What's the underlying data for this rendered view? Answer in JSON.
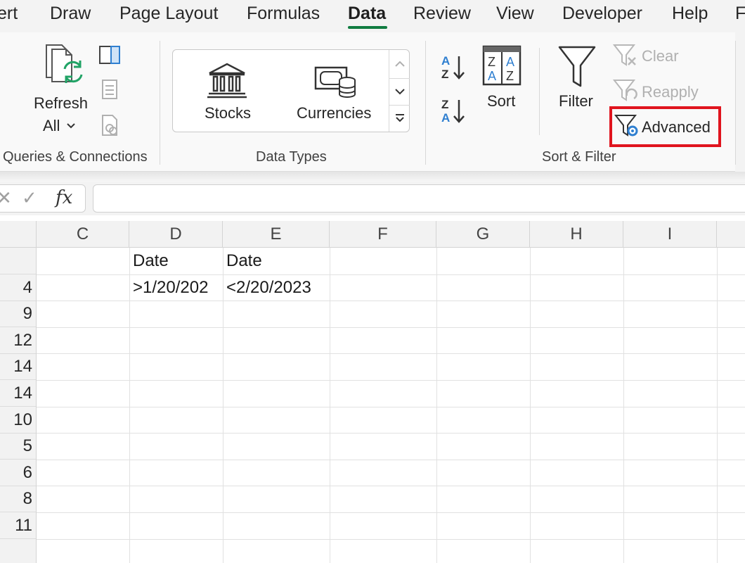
{
  "menu": {
    "tabs": [
      {
        "label": "ert",
        "active": false
      },
      {
        "label": "Draw",
        "active": false
      },
      {
        "label": "Page Layout",
        "active": false
      },
      {
        "label": "Formulas",
        "active": false
      },
      {
        "label": "Data",
        "active": true
      },
      {
        "label": "Review",
        "active": false
      },
      {
        "label": "View",
        "active": false
      },
      {
        "label": "Developer",
        "active": false
      },
      {
        "label": "Help",
        "active": false
      },
      {
        "label": "F",
        "active": false
      }
    ]
  },
  "ribbon": {
    "queries": {
      "refresh_label": "Refresh",
      "all_label": "All",
      "group_label": "Queries & Connections"
    },
    "data_types": {
      "stocks_label": "Stocks",
      "currencies_label": "Currencies",
      "group_label": "Data Types"
    },
    "sort_filter": {
      "sort_label": "Sort",
      "filter_label": "Filter",
      "clear_label": "Clear",
      "reapply_label": "Reapply",
      "advanced_label": "Advanced",
      "group_label": "Sort & Filter"
    },
    "colors": {
      "accent_green": "#107c41",
      "highlight_red": "#e0141e",
      "sort_blue": "#2f7fd0"
    }
  },
  "formula_bar": {
    "fx_label": "fx",
    "cancel_glyph": "✕",
    "enter_glyph": "✓",
    "value": ""
  },
  "sheet": {
    "columns": [
      "C",
      "D",
      "E",
      "F",
      "G",
      "H",
      "I"
    ],
    "rows": [
      {
        "header": "",
        "cells": [
          "",
          "Date",
          "Date",
          "",
          "",
          "",
          ""
        ]
      },
      {
        "header": "4",
        "cells": [
          "",
          ">1/20/202",
          "<2/20/2023",
          "",
          "",
          "",
          ""
        ]
      },
      {
        "header": "9",
        "cells": [
          "",
          "",
          "",
          "",
          "",
          "",
          ""
        ]
      },
      {
        "header": "12",
        "cells": [
          "",
          "",
          "",
          "",
          "",
          "",
          ""
        ]
      },
      {
        "header": "14",
        "cells": [
          "",
          "",
          "",
          "",
          "",
          "",
          ""
        ]
      },
      {
        "header": "14",
        "cells": [
          "",
          "",
          "",
          "",
          "",
          "",
          ""
        ]
      },
      {
        "header": "10",
        "cells": [
          "",
          "",
          "",
          "",
          "",
          "",
          ""
        ]
      },
      {
        "header": "5",
        "cells": [
          "",
          "",
          "",
          "",
          "",
          "",
          ""
        ]
      },
      {
        "header": "6",
        "cells": [
          "",
          "",
          "",
          "",
          "",
          "",
          ""
        ]
      },
      {
        "header": "8",
        "cells": [
          "",
          "",
          "",
          "",
          "",
          "",
          ""
        ]
      },
      {
        "header": "11",
        "cells": [
          "",
          "",
          "",
          "",
          "",
          "",
          ""
        ]
      }
    ]
  }
}
